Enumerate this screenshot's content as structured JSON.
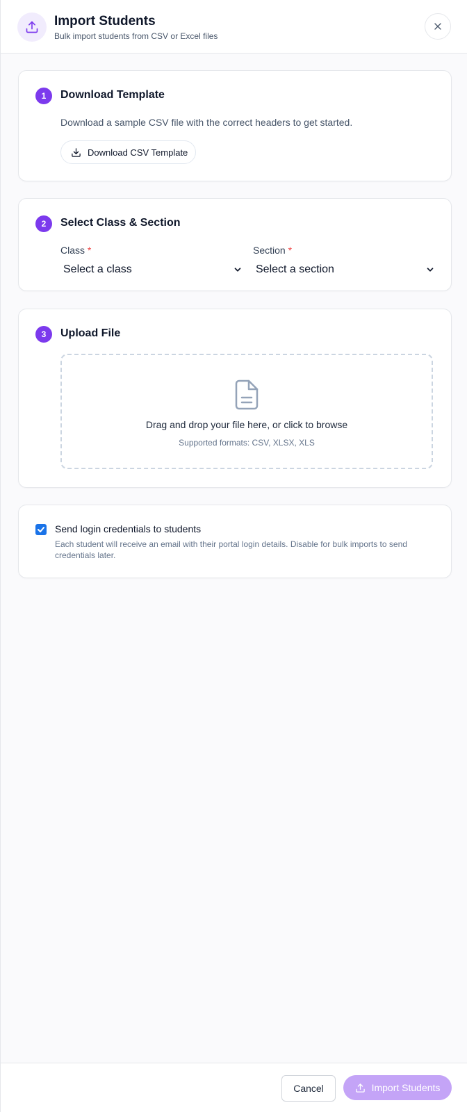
{
  "header": {
    "title": "Import Students",
    "subtitle": "Bulk import students from CSV or Excel files",
    "icon": "upload-icon",
    "accent": "#7c3aed"
  },
  "steps": [
    {
      "number": "1",
      "title": "Download Template",
      "description": "Download a sample CSV file with the correct headers to get started.",
      "button_label": "Download CSV Template",
      "button_icon": "download-icon"
    },
    {
      "number": "2",
      "title": "Select Class & Section",
      "class_label": "Class",
      "class_value": "Select a class",
      "section_label": "Section",
      "section_value": "Select a section",
      "required_marker": "*"
    },
    {
      "number": "3",
      "title": "Upload File",
      "dropzone_text": "Drag and drop your file here, or click to browse",
      "formats_text": "Supported formats: CSV, XLSX, XLS",
      "icon": "file-icon"
    }
  ],
  "credentials": {
    "checked": true,
    "label": "Send login credentials to students",
    "help": "Each student will receive an email with their portal login details. Disable for bulk imports to send credentials later."
  },
  "footer": {
    "cancel_label": "Cancel",
    "import_label": "Import Students",
    "import_color": "#c4a4f7"
  }
}
